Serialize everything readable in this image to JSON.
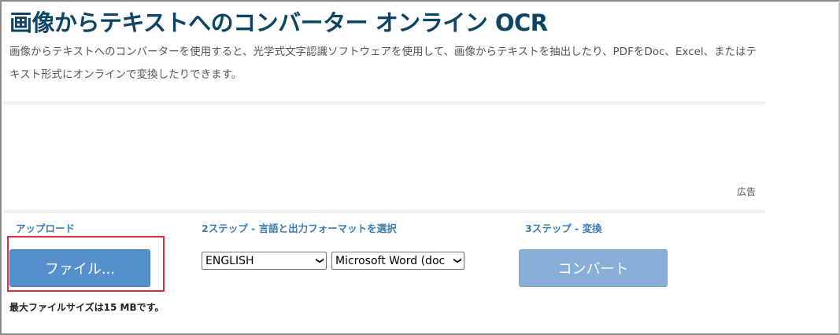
{
  "header": {
    "title": "画像からテキストへのコンバーター オンライン OCR",
    "description": "画像からテキストへのコンバーターを使用すると、光学式文字認識ソフトウェアを使用して、画像からテキストを抽出したり、PDFをDoc、Excel、またはテキスト形式にオンラインで変換したりできます。"
  },
  "ad_label": "広告",
  "step1": {
    "heading": "アップロード",
    "button": "ファイル...",
    "max_size": "最大ファイルサイズは15 MBです。"
  },
  "step2": {
    "heading": "2ステップ - 言語と出力フォーマットを選択",
    "language": "ENGLISH",
    "format": "Microsoft Word (doc"
  },
  "step3": {
    "heading": "3ステップ - 変換",
    "button": "コンバート"
  },
  "colors": {
    "title": "#0b4566",
    "heading": "#3b7bb3",
    "file_button": "#5590cc",
    "convert_button": "#87afd8",
    "highlight": "#d8323a"
  }
}
